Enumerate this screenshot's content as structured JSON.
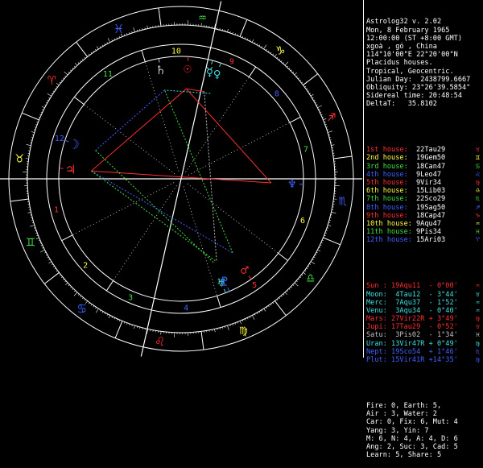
{
  "header": {
    "lines": [
      "Astrolog32 v. 2.02",
      "Mon, 8 February 1965",
      "12:00:00 (ST +8:00 GMT)",
      "xgoà , gó , China",
      "114°10'00\"E 22°20'00\"N",
      "Placidus houses.",
      "Tropical, Geocentric.",
      "Julian Day:  2438799.6667",
      "Obliquity: 23°26'39.5854\"",
      "Sidereal time: 20:48:54",
      "DeltaT:   35.8102"
    ]
  },
  "houses": [
    {
      "label": "1st house:",
      "value": "22Tau29",
      "glyph": "♉",
      "color": "#ff3030"
    },
    {
      "label": "2nd house:",
      "value": "19Gem50",
      "glyph": "♊",
      "color": "#ffff40"
    },
    {
      "label": "3rd house:",
      "value": "18Can47",
      "glyph": "♋",
      "color": "#40e040"
    },
    {
      "label": "4th house:",
      "value": "9Leo47",
      "glyph": "♌",
      "color": "#4060ff"
    },
    {
      "label": "5th house:",
      "value": "9Vir34",
      "glyph": "♍",
      "color": "#ff3030"
    },
    {
      "label": "6th house:",
      "value": "15Lib03",
      "glyph": "♎",
      "color": "#ffff40"
    },
    {
      "label": "7th house:",
      "value": "22Sco29",
      "glyph": "♏",
      "color": "#40e040"
    },
    {
      "label": "8th house:",
      "value": "19Sag50",
      "glyph": "♐",
      "color": "#4060ff"
    },
    {
      "label": "9th house:",
      "value": "18Cap47",
      "glyph": "♑",
      "color": "#ff3030"
    },
    {
      "label": "10th house:",
      "value": "9Aqu47",
      "glyph": "♒",
      "color": "#ffff40"
    },
    {
      "label": "11th house:",
      "value": "9Pis34",
      "glyph": "♓",
      "color": "#40e040"
    },
    {
      "label": "12th house:",
      "value": "15Ari03",
      "glyph": "♈",
      "color": "#4060ff"
    }
  ],
  "planets": [
    {
      "text": "Sun : 19Aqu11  - 0°00'",
      "glyph": "♒",
      "color": "#ff3030"
    },
    {
      "text": "Moon:  4Tau12  - 3°44'",
      "glyph": "♉",
      "color": "#40e0e0"
    },
    {
      "text": "Merc:  7Aqu37  - 1°52'",
      "glyph": "♒",
      "color": "#40e0e0"
    },
    {
      "text": "Venu:  3Aqu34  - 0°40'",
      "glyph": "♒",
      "color": "#40e0e0"
    },
    {
      "text": "Mars: 27Vir22R + 3°49'",
      "glyph": "♍",
      "color": "#ff3030"
    },
    {
      "text": "Jupi: 17Tau29  - 0°52'",
      "glyph": "♉",
      "color": "#ff3030"
    },
    {
      "text": "Satu:  3Pis02  - 1°34'",
      "glyph": "♓",
      "color": "#c0c0c0"
    },
    {
      "text": "Uran: 13Vir47R + 0°49'",
      "glyph": "♍",
      "color": "#40e0e0"
    },
    {
      "text": "Nept: 19Sco54  + 1°46'",
      "glyph": "♏",
      "color": "#4060ff"
    },
    {
      "text": "Plut: 15Vir41R +14°35'",
      "glyph": "♍",
      "color": "#4060ff"
    }
  ],
  "summary": [
    "Fire: 0, Earth: 5,",
    "Air : 3, Water: 2",
    "Car: 0, Fix: 6, Mut: 4",
    "Yang: 3, Yin: 7",
    "M: 6, N: 4, A: 4, D: 6",
    "Ang: 2, Suc: 3, Cad: 5",
    "Learn: 5, Share: 5"
  ],
  "wheel": {
    "ascendant_longitude": 52.48,
    "signs": [
      {
        "glyph": "♈",
        "color": "#ff3030"
      },
      {
        "glyph": "♉",
        "color": "#ffff40"
      },
      {
        "glyph": "♊",
        "color": "#40e040"
      },
      {
        "glyph": "♋",
        "color": "#4060ff"
      },
      {
        "glyph": "♌",
        "color": "#ff3030"
      },
      {
        "glyph": "♍",
        "color": "#ffff40"
      },
      {
        "glyph": "♎",
        "color": "#40e040"
      },
      {
        "glyph": "♏",
        "color": "#4060ff"
      },
      {
        "glyph": "♐",
        "color": "#ff3030"
      },
      {
        "glyph": "♑",
        "color": "#ffff40"
      },
      {
        "glyph": "♒",
        "color": "#40e040"
      },
      {
        "glyph": "♓",
        "color": "#4060ff"
      }
    ],
    "house_cusps": [
      52.48,
      79.83,
      108.78,
      129.78,
      159.57,
      195.05,
      232.48,
      259.83,
      288.78,
      309.78,
      339.57,
      15.05
    ],
    "house_numbers": [
      {
        "n": "1",
        "color": "#ff3030"
      },
      {
        "n": "2",
        "color": "#ffff40"
      },
      {
        "n": "3",
        "color": "#40e040"
      },
      {
        "n": "4",
        "color": "#4060ff"
      },
      {
        "n": "5",
        "color": "#ff3030"
      },
      {
        "n": "6",
        "color": "#ffff40"
      },
      {
        "n": "7",
        "color": "#40e040"
      },
      {
        "n": "8",
        "color": "#4060ff"
      },
      {
        "n": "9",
        "color": "#ff3030"
      },
      {
        "n": "10",
        "color": "#ffff40"
      },
      {
        "n": "11",
        "color": "#40e040"
      },
      {
        "n": "12",
        "color": "#4060ff"
      }
    ],
    "planets": [
      {
        "name": "Sun",
        "glyph": "☉",
        "lon": 319.18,
        "color": "#ff3030"
      },
      {
        "name": "Moon",
        "glyph": "☽",
        "lon": 34.2,
        "color": "#4060ff"
      },
      {
        "name": "Mercury",
        "glyph": "☿",
        "lon": 307.62,
        "color": "#40e0e0"
      },
      {
        "name": "Venus",
        "glyph": "♀",
        "lon": 303.57,
        "color": "#40e0e0"
      },
      {
        "name": "Mars",
        "glyph": "♂",
        "lon": 177.37,
        "color": "#ff3030"
      },
      {
        "name": "Jupiter",
        "glyph": "♃",
        "lon": 47.48,
        "color": "#ff3030"
      },
      {
        "name": "Saturn",
        "glyph": "♄",
        "lon": 333.03,
        "color": "#c0c0c0"
      },
      {
        "name": "Uranus",
        "glyph": "♅",
        "lon": 163.78,
        "color": "#40e0e0"
      },
      {
        "name": "Neptune",
        "glyph": "♆",
        "lon": 229.9,
        "color": "#4060ff"
      },
      {
        "name": "Pluto",
        "glyph": "♇",
        "lon": 165.68,
        "color": "#4060ff"
      }
    ],
    "aspects": [
      {
        "from": "Sun",
        "to": "Jupiter",
        "color": "#ff3030"
      },
      {
        "from": "Sun",
        "to": "Neptune",
        "color": "#ff3030"
      },
      {
        "from": "Jupiter",
        "to": "Neptune",
        "color": "#ff3030"
      },
      {
        "from": "Jupiter",
        "to": "Mars",
        "color": "#4060ff"
      },
      {
        "from": "Mars",
        "to": "Saturn",
        "color": "#40e040"
      },
      {
        "from": "Jupiter",
        "to": "Pluto",
        "color": "#40e040"
      },
      {
        "from": "Moon",
        "to": "Uranus",
        "color": "#40e040"
      },
      {
        "from": "Sun",
        "to": "Mercury",
        "color": "#ff3030"
      },
      {
        "from": "Venus",
        "to": "Saturn",
        "color": "#40e0e0"
      },
      {
        "from": "Moon",
        "to": "Saturn",
        "color": "#4060ff"
      },
      {
        "from": "Mercury",
        "to": "Pluto",
        "color": "#c0c0c0"
      }
    ]
  }
}
